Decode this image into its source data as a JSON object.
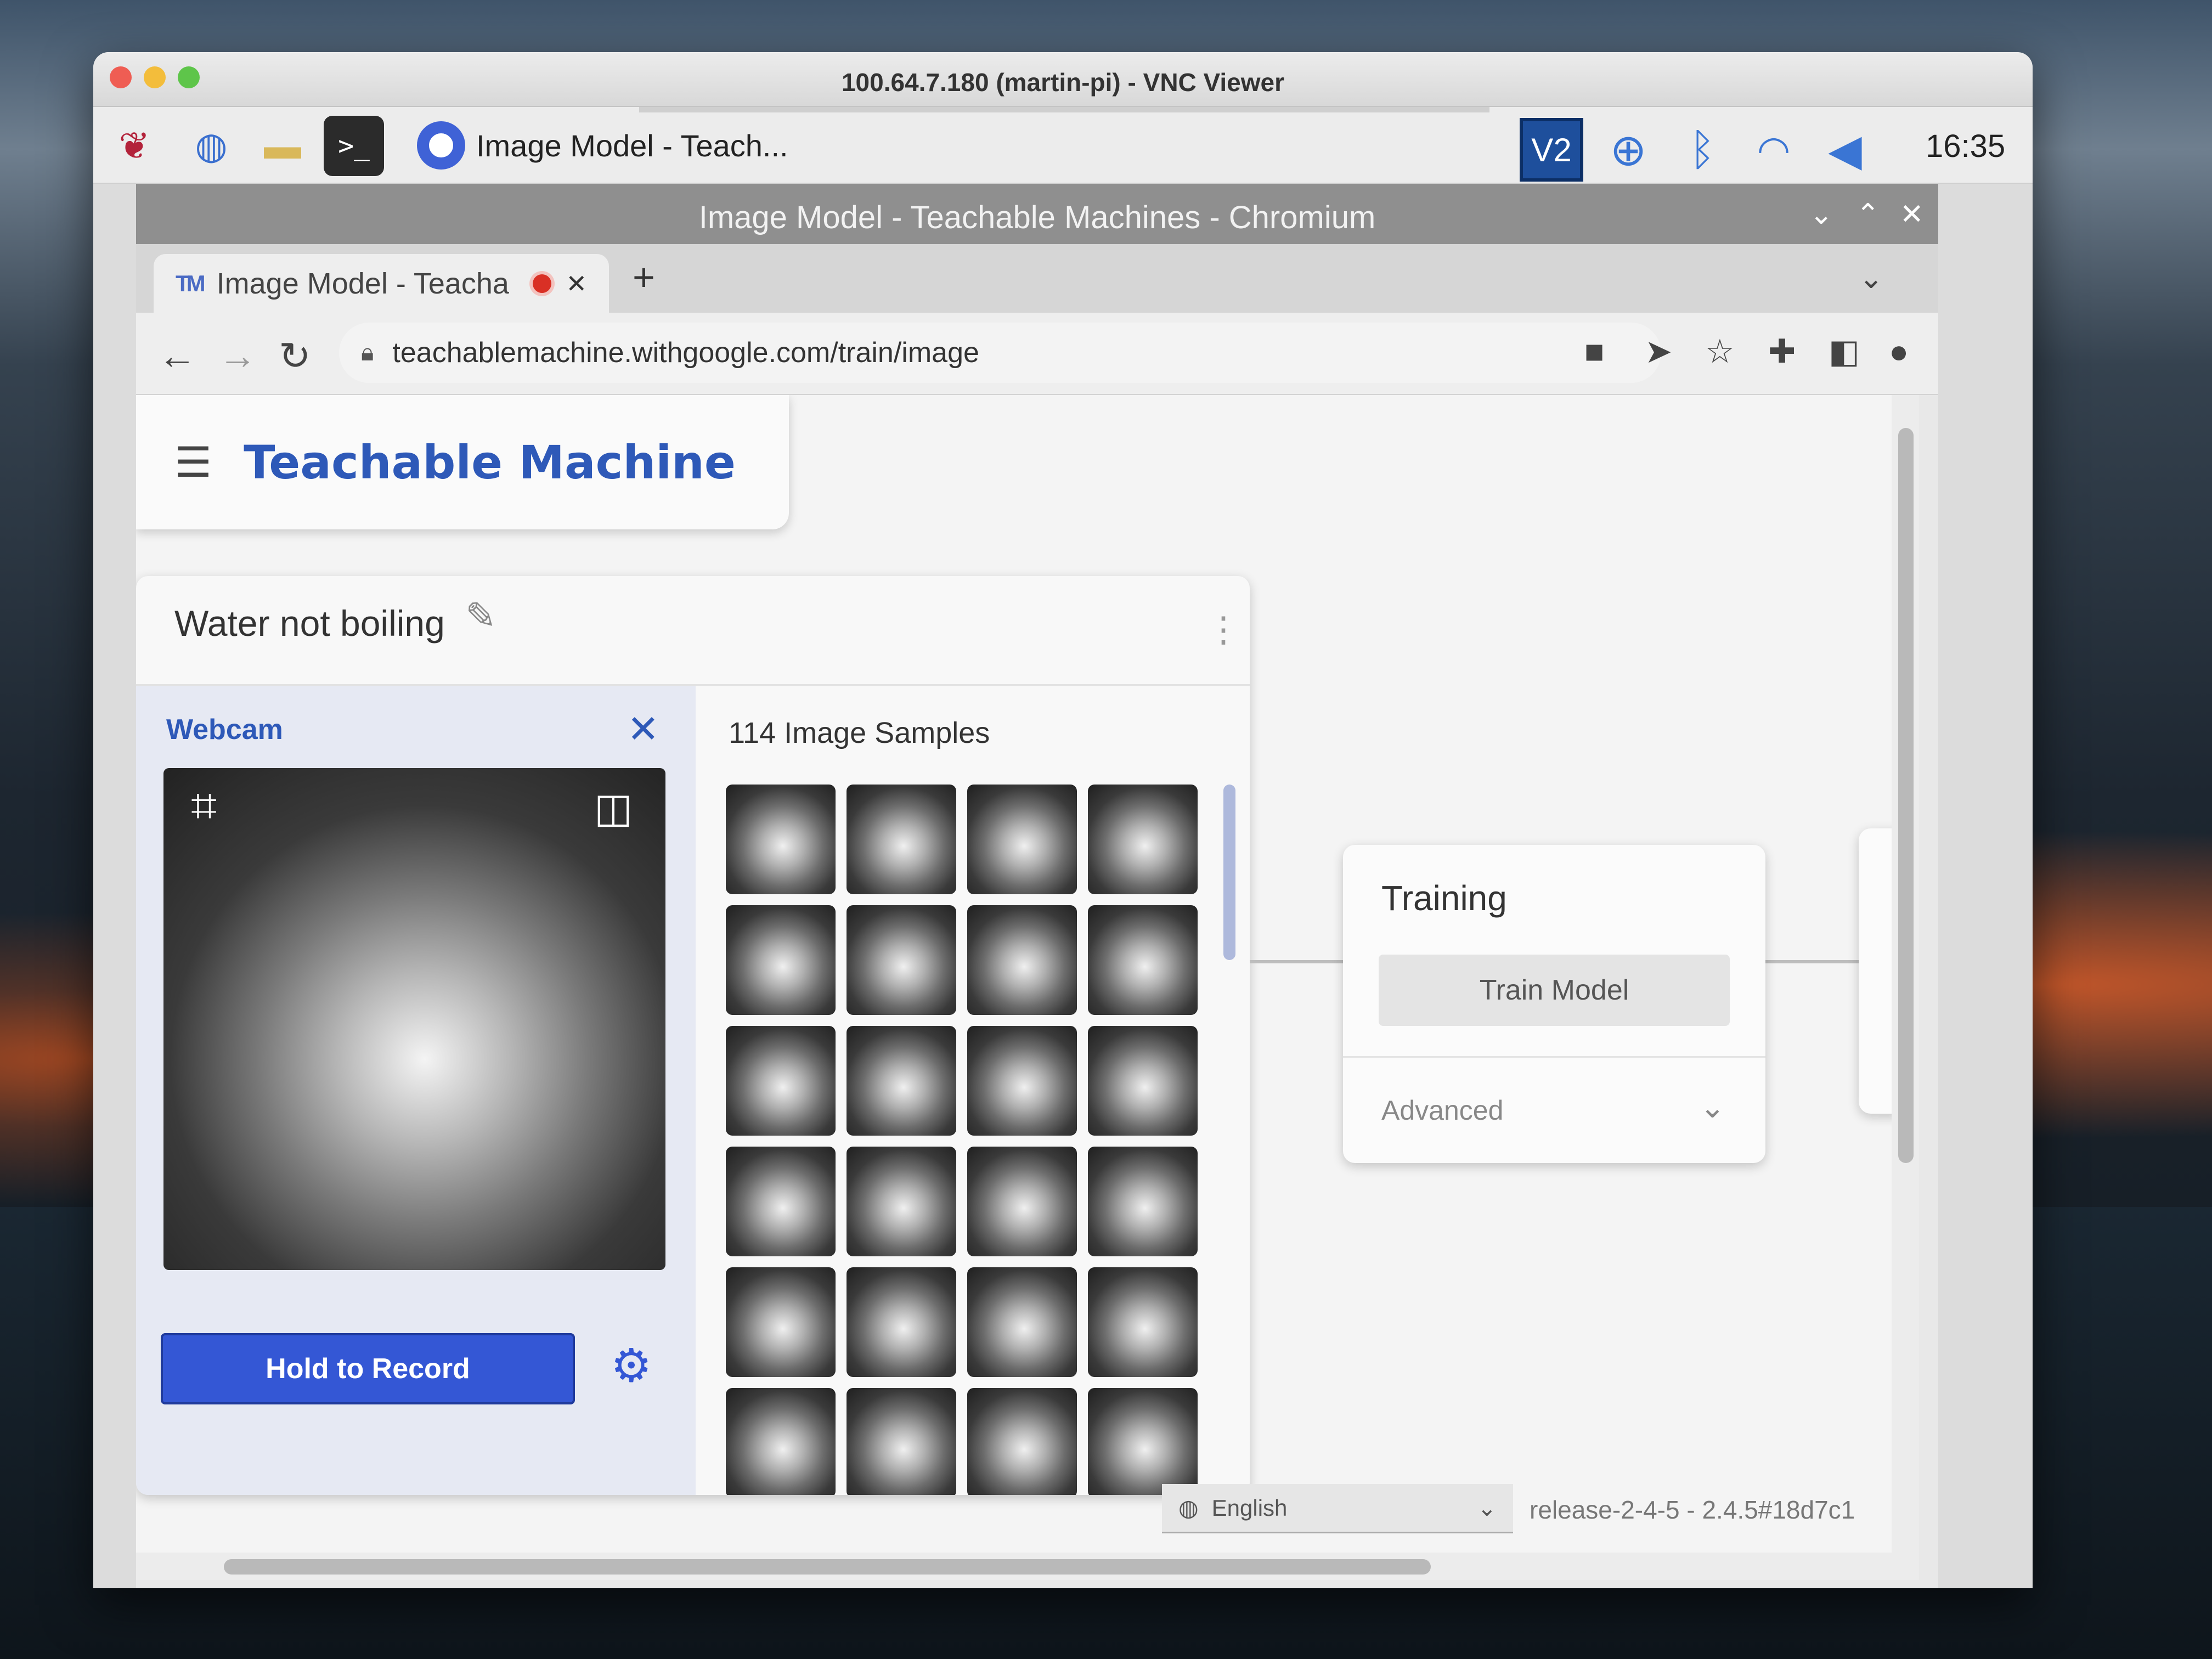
{
  "vnc": {
    "title": "100.64.7.180 (martin-pi) - VNC Viewer"
  },
  "taskbar": {
    "app_label": "Image Model - Teach...",
    "vnc_icon_label": "V2",
    "clock": "16:35"
  },
  "browser": {
    "window_title": "Image Model - Teachable Machines - Chromium",
    "tab_title": "Image Model - Teacha",
    "tab_favicon": "TM",
    "url": "teachablemachine.withgoogle.com/train/image"
  },
  "app": {
    "title": "Teachable Machine",
    "class_card": {
      "name": "Water not boiling",
      "webcam_label": "Webcam",
      "record_button": "Hold to Record",
      "samples_label": "114 Image Samples",
      "visible_thumbnail_count": 24
    },
    "training": {
      "title": "Training",
      "train_button": "Train Model",
      "advanced_label": "Advanced"
    },
    "footer": {
      "language": "English",
      "release": "release-2-4-5 - 2.4.5#18d7c1"
    }
  },
  "colors": {
    "brand_blue": "#2e59b8",
    "record_button": "#3457d5",
    "chromium_title": "#8f8f8f"
  },
  "icons": [
    "raspberry-pi-icon",
    "globe-icon",
    "folder-icon",
    "terminal-icon",
    "chromium-icon",
    "vnc-icon",
    "download-icon",
    "bluetooth-icon",
    "wifi-icon",
    "volume-icon",
    "back-icon",
    "forward-icon",
    "reload-icon",
    "lock-icon",
    "camera-icon",
    "send-icon",
    "star-icon",
    "extensions-icon",
    "sidepanel-icon",
    "profile-icon",
    "kebab-icon",
    "hamburger-icon",
    "pencil-icon",
    "close-icon",
    "crop-icon",
    "flip-icon",
    "gear-icon",
    "chevron-down-icon",
    "globe-small-icon"
  ]
}
